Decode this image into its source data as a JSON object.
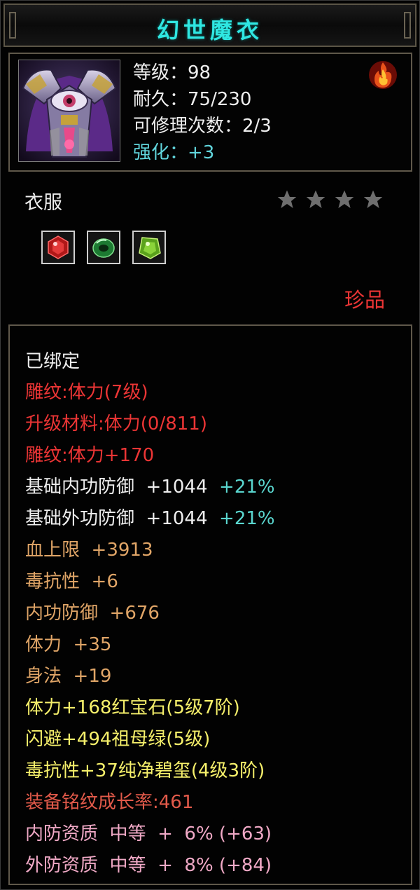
{
  "title": "幻世魔衣",
  "header": {
    "level": "等级：98",
    "durability": "耐久：75/230",
    "repair": "可修理次数：2/3",
    "enhance": "强化：+3"
  },
  "category": "衣服",
  "star_rating": 4,
  "gems": [
    "red-gem-icon",
    "green-ring-gem-icon",
    "green-gem-icon"
  ],
  "rarity": "珍品",
  "colors": {
    "title": "#2fe7e2",
    "white": "#eeeeee",
    "red": "#ec3535",
    "orange": "#e0a567",
    "yellow": "#f6f06b",
    "teal": "#5ad6cf"
  },
  "attributes": {
    "bound": "已绑定",
    "carving": "雕纹:体力(7级)",
    "upgrade_material": "升级材料:体力(0/811)",
    "carving_bonus": "雕纹:体力+170",
    "base_inner_def": {
      "label": "基础内功防御",
      "value": "+1044",
      "pct": "+21%"
    },
    "base_outer_def": {
      "label": "基础外功防御",
      "value": "+1044",
      "pct": "+21%"
    },
    "hp_max": {
      "label": "血上限",
      "value": "+3913"
    },
    "poison_res": {
      "label": "毒抗性",
      "value": "+6"
    },
    "inner_def": {
      "label": "内功防御",
      "value": "+676"
    },
    "stamina": {
      "label": "体力",
      "value": "+35"
    },
    "agility": {
      "label": "身法",
      "value": "+19"
    },
    "gem_1": "体力+168红宝石(5级7阶)",
    "gem_2": "闪避+494祖母绿(5级)",
    "gem_3": "毒抗性+37纯净碧玺(4级3阶)",
    "growth": "装备铭纹成长率:461",
    "inner_quality": {
      "label": "内防资质",
      "grade": "中等",
      "value": "+  6% (+63)"
    },
    "outer_quality": {
      "label": "外防资质",
      "grade": "中等",
      "value": "+  8% (+84)"
    }
  }
}
